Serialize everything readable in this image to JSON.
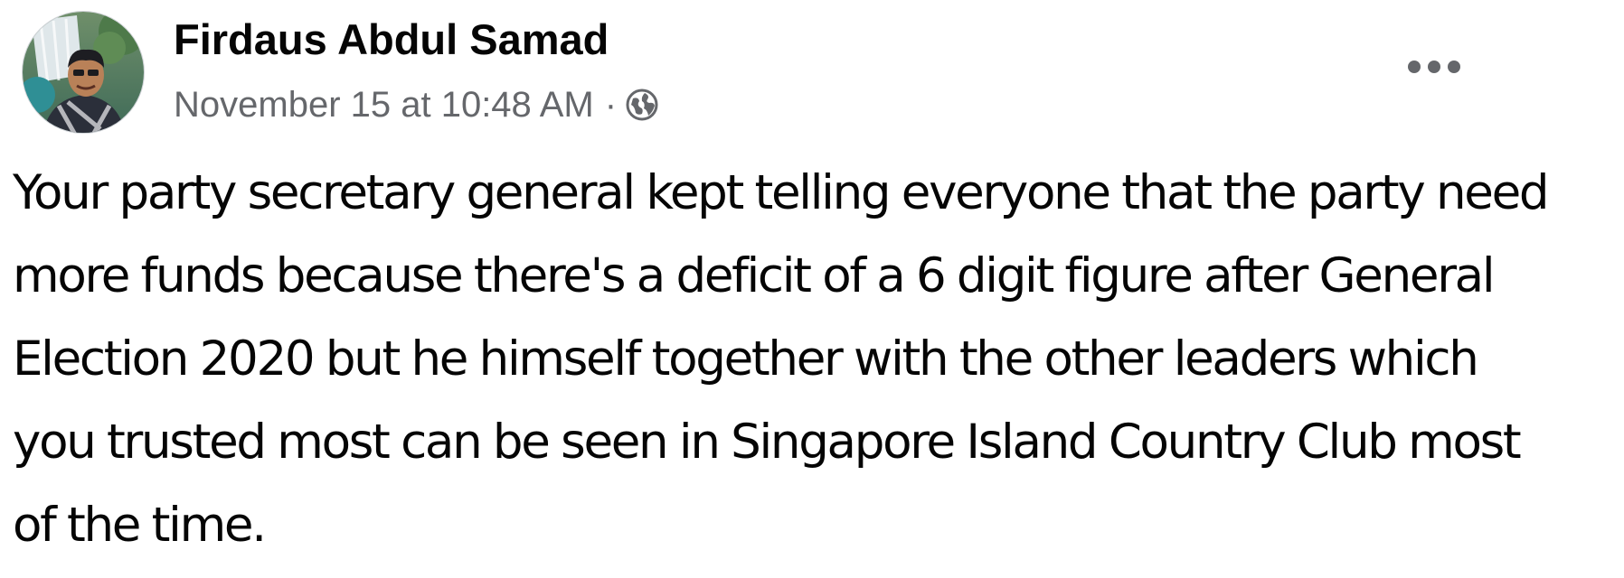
{
  "post": {
    "author_name": "Firdaus Abdul Samad",
    "timestamp": "November 15 at 10:48 AM",
    "separator": "·",
    "audience_icon": "globe-icon",
    "menu_icon": "more-options-icon",
    "body_lines": [
      "Your party secretary general kept telling everyone that the party need",
      "more funds because there's a deficit of a 6 digit figure after General",
      "Election 2020 but he himself together with the other leaders which",
      "you trusted most can be seen in Singapore Island Country Club most",
      "of the time."
    ]
  },
  "colors": {
    "text_primary": "#050505",
    "text_secondary": "#65676b"
  }
}
